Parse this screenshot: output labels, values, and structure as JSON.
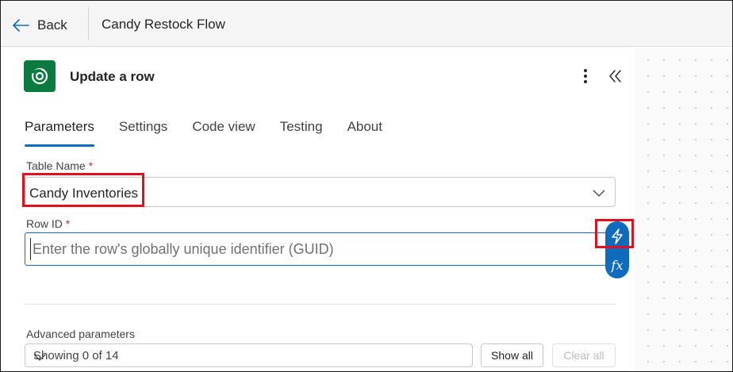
{
  "header": {
    "back_label": "Back",
    "flow_title": "Candy Restock Flow"
  },
  "action": {
    "title": "Update a row",
    "connector_icon": "dataverse-icon",
    "brand_color": "#0b7a3e"
  },
  "tabs": [
    {
      "label": "Parameters",
      "active": true
    },
    {
      "label": "Settings",
      "active": false
    },
    {
      "label": "Code view",
      "active": false
    },
    {
      "label": "Testing",
      "active": false
    },
    {
      "label": "About",
      "active": false
    }
  ],
  "fields": {
    "table_name": {
      "label": "Table Name",
      "required_marker": "*",
      "value": "Candy Inventories"
    },
    "row_id": {
      "label": "Row ID",
      "required_marker": "*",
      "value": "",
      "placeholder": "Enter the row's globally unique identifier (GUID)"
    }
  },
  "side_buttons": {
    "dynamic_content_icon": "lightning-icon",
    "expression_label": "fx"
  },
  "advanced": {
    "label": "Advanced parameters",
    "selected": "Showing 0 of 14",
    "show_all_label": "Show all",
    "clear_all_label": "Clear all"
  },
  "colors": {
    "accent": "#0f6cbd",
    "highlight": "#e0101f"
  }
}
